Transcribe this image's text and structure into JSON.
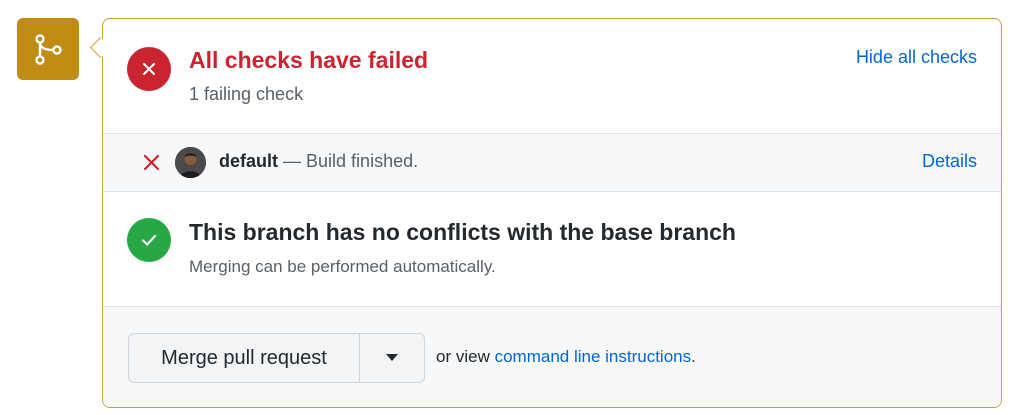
{
  "checks": {
    "title": "All checks have failed",
    "summary": "1 failing check",
    "toggle_label": "Hide all checks",
    "items": [
      {
        "name": "default",
        "description": "— Build finished.",
        "details_label": "Details"
      }
    ]
  },
  "conflicts": {
    "title": "This branch has no conflicts with the base branch",
    "subtitle": "Merging can be performed automatically."
  },
  "merge": {
    "button_label": "Merge pull request",
    "note_prefix": "or view",
    "note_link": "command line instructions",
    "note_suffix": "."
  },
  "colors": {
    "accent_merge": "#c08c13",
    "fail": "#cb2431",
    "success": "#28a745",
    "link": "#0366d6"
  },
  "icons": {
    "merge_badge": "git-merge-icon",
    "fail_status": "x-circle-icon",
    "check_fail": "x-icon",
    "success_status": "check-circle-icon",
    "dropdown": "triangle-down-icon"
  }
}
